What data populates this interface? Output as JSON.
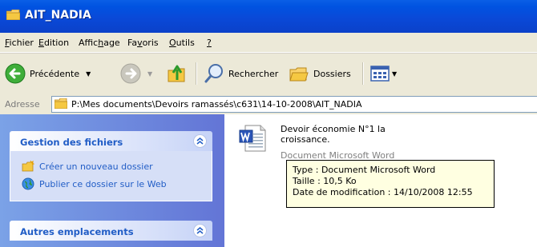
{
  "window": {
    "title": "AIT_NADIA"
  },
  "menu": [
    {
      "label": "Fichier",
      "accel": "F"
    },
    {
      "label": "Edition",
      "accel": "E"
    },
    {
      "label": "Affichage",
      "accel": "h"
    },
    {
      "label": "Favoris",
      "accel": "v"
    },
    {
      "label": "Outils",
      "accel": "O"
    },
    {
      "label": "?",
      "accel": "?"
    }
  ],
  "toolbar": {
    "back_label": "Précédente",
    "search_label": "Rechercher",
    "folders_label": "Dossiers"
  },
  "address": {
    "label": "Adresse",
    "path": "P:\\Mes documents\\Devoirs ramassés\\c631\\14-10-2008\\AIT_NADIA"
  },
  "sidebar": {
    "file_tasks": {
      "title": "Gestion des fichiers",
      "items": [
        {
          "label": "Créer un nouveau dossier",
          "icon": "new-folder-icon"
        },
        {
          "label": "Publier ce dossier sur le Web",
          "icon": "publish-web-icon"
        }
      ]
    },
    "other_places": {
      "title": "Autres emplacements"
    }
  },
  "file": {
    "name_line1": "Devoir économie N°1  la",
    "name_line2": "croissance.",
    "type": "Document Microsoft Word"
  },
  "tooltip": {
    "type": "Type : Document Microsoft Word",
    "size": "Taille  : 10,5 Ko",
    "modified": "Date de modification : 14/10/2008 12:55"
  },
  "colors": {
    "titlebar": "#0a49d8",
    "link": "#215dc6",
    "tooltip_bg": "#ffffe1"
  }
}
